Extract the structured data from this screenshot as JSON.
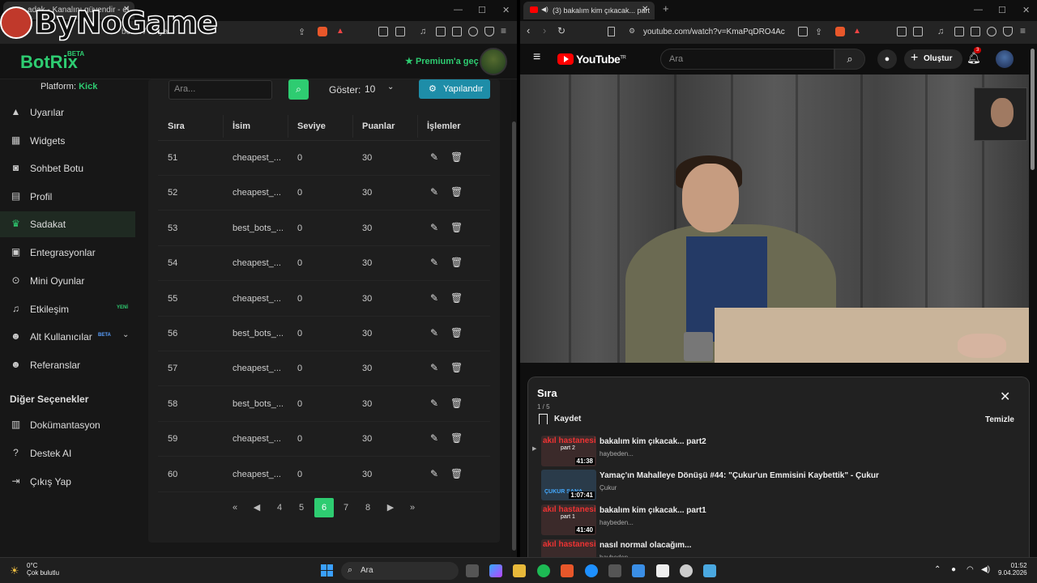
{
  "left_browser": {
    "tab_title": "adak - Kanalını güvendir - el...",
    "address": "botrix  /  d  /  ya",
    "overlay_logo": "ByNoGame"
  },
  "botrix": {
    "brand": "BotRix",
    "brand_badge": "BETA",
    "premium_label": "Premium'a geç",
    "platform_label": "Platform:",
    "platform_value": "Kick",
    "nav": [
      {
        "label": "Uyarılar",
        "icon": "warning-icon"
      },
      {
        "label": "Widgets",
        "icon": "grid-icon"
      },
      {
        "label": "Sohbet Botu",
        "icon": "robot-icon"
      },
      {
        "label": "Profil",
        "icon": "id-card-icon"
      },
      {
        "label": "Sadakat",
        "icon": "trophy-icon"
      },
      {
        "label": "Entegrasyonlar",
        "icon": "plug-icon"
      },
      {
        "label": "Mini Oyunlar",
        "icon": "gamepad-icon"
      },
      {
        "label": "Etkileşim",
        "icon": "music-icon",
        "badge": "YENİ"
      },
      {
        "label": "Alt Kullanıcılar",
        "icon": "users-icon",
        "badge": "BETA"
      },
      {
        "label": "Referanslar",
        "icon": "users-icon"
      }
    ],
    "other_title": "Diğer Seçenekler",
    "other_nav": [
      {
        "label": "Dokümantasyon",
        "icon": "book-icon"
      },
      {
        "label": "Destek AI",
        "icon": "question-icon"
      },
      {
        "label": "Çıkış Yap",
        "icon": "logout-icon"
      }
    ],
    "search_placeholder": "Ara...",
    "show_label": "Göster:",
    "show_value": "10",
    "config_label": "Yapılandır",
    "columns": [
      "Sıra",
      "İsim",
      "Seviye",
      "Puanlar",
      "İşlemler"
    ],
    "rows": [
      {
        "rank": "51",
        "name": "cheapest_...",
        "level": "0",
        "points": "30"
      },
      {
        "rank": "52",
        "name": "cheapest_...",
        "level": "0",
        "points": "30"
      },
      {
        "rank": "53",
        "name": "best_bots_...",
        "level": "0",
        "points": "30"
      },
      {
        "rank": "54",
        "name": "cheapest_...",
        "level": "0",
        "points": "30"
      },
      {
        "rank": "55",
        "name": "cheapest_...",
        "level": "0",
        "points": "30"
      },
      {
        "rank": "56",
        "name": "best_bots_...",
        "level": "0",
        "points": "30"
      },
      {
        "rank": "57",
        "name": "cheapest_...",
        "level": "0",
        "points": "30"
      },
      {
        "rank": "58",
        "name": "best_bots_...",
        "level": "0",
        "points": "30"
      },
      {
        "rank": "59",
        "name": "cheapest_...",
        "level": "0",
        "points": "30"
      },
      {
        "rank": "60",
        "name": "cheapest_...",
        "level": "0",
        "points": "30"
      }
    ],
    "pages": [
      "4",
      "5",
      "6",
      "7",
      "8"
    ],
    "current_page": "6"
  },
  "right_browser": {
    "tab_title": "(3) bakalım kim çıkacak... part",
    "address": "youtube.com/watch?v=KmaPqDRO4Ac"
  },
  "youtube": {
    "logo": "YouTube",
    "region": "TR",
    "search_placeholder": "Ara",
    "create_label": "Oluştur",
    "notif_count": "3",
    "queue_title": "Sıra",
    "queue_count": "1 / 5",
    "save_label": "Kaydet",
    "clear_label": "Temizle",
    "items": [
      {
        "title": "bakalım kim çıkacak... part2",
        "channel": "haybeden...",
        "duration": "41:38",
        "thumb": "akıl hastanesi",
        "sub": "part 2"
      },
      {
        "title": "Yamaç'ın Mahalleye Dönüşü #44: \"Çukur'un Emmisini Kaybettik\" - Çukur",
        "channel": "Çukur",
        "duration": "1:07:41",
        "thumb": "ÇUKUR SANA",
        "sub": ""
      },
      {
        "title": "bakalım kim çıkacak... part1",
        "channel": "haybeden...",
        "duration": "41:40",
        "thumb": "akıl hastanesi",
        "sub": "part 1"
      },
      {
        "title": "nasıl normal olacağım...",
        "channel": "haybeden...",
        "duration": "",
        "thumb": "akıl hastanesi",
        "sub": ""
      }
    ]
  },
  "taskbar": {
    "temp": "0°C",
    "weather": "Çok bulutlu",
    "search": "Ara",
    "time": "01:52",
    "date": "9.04.2026"
  },
  "colors": {
    "accent": "#2ecc71",
    "config": "#1e8da8",
    "yt_red": "#ff0000"
  }
}
